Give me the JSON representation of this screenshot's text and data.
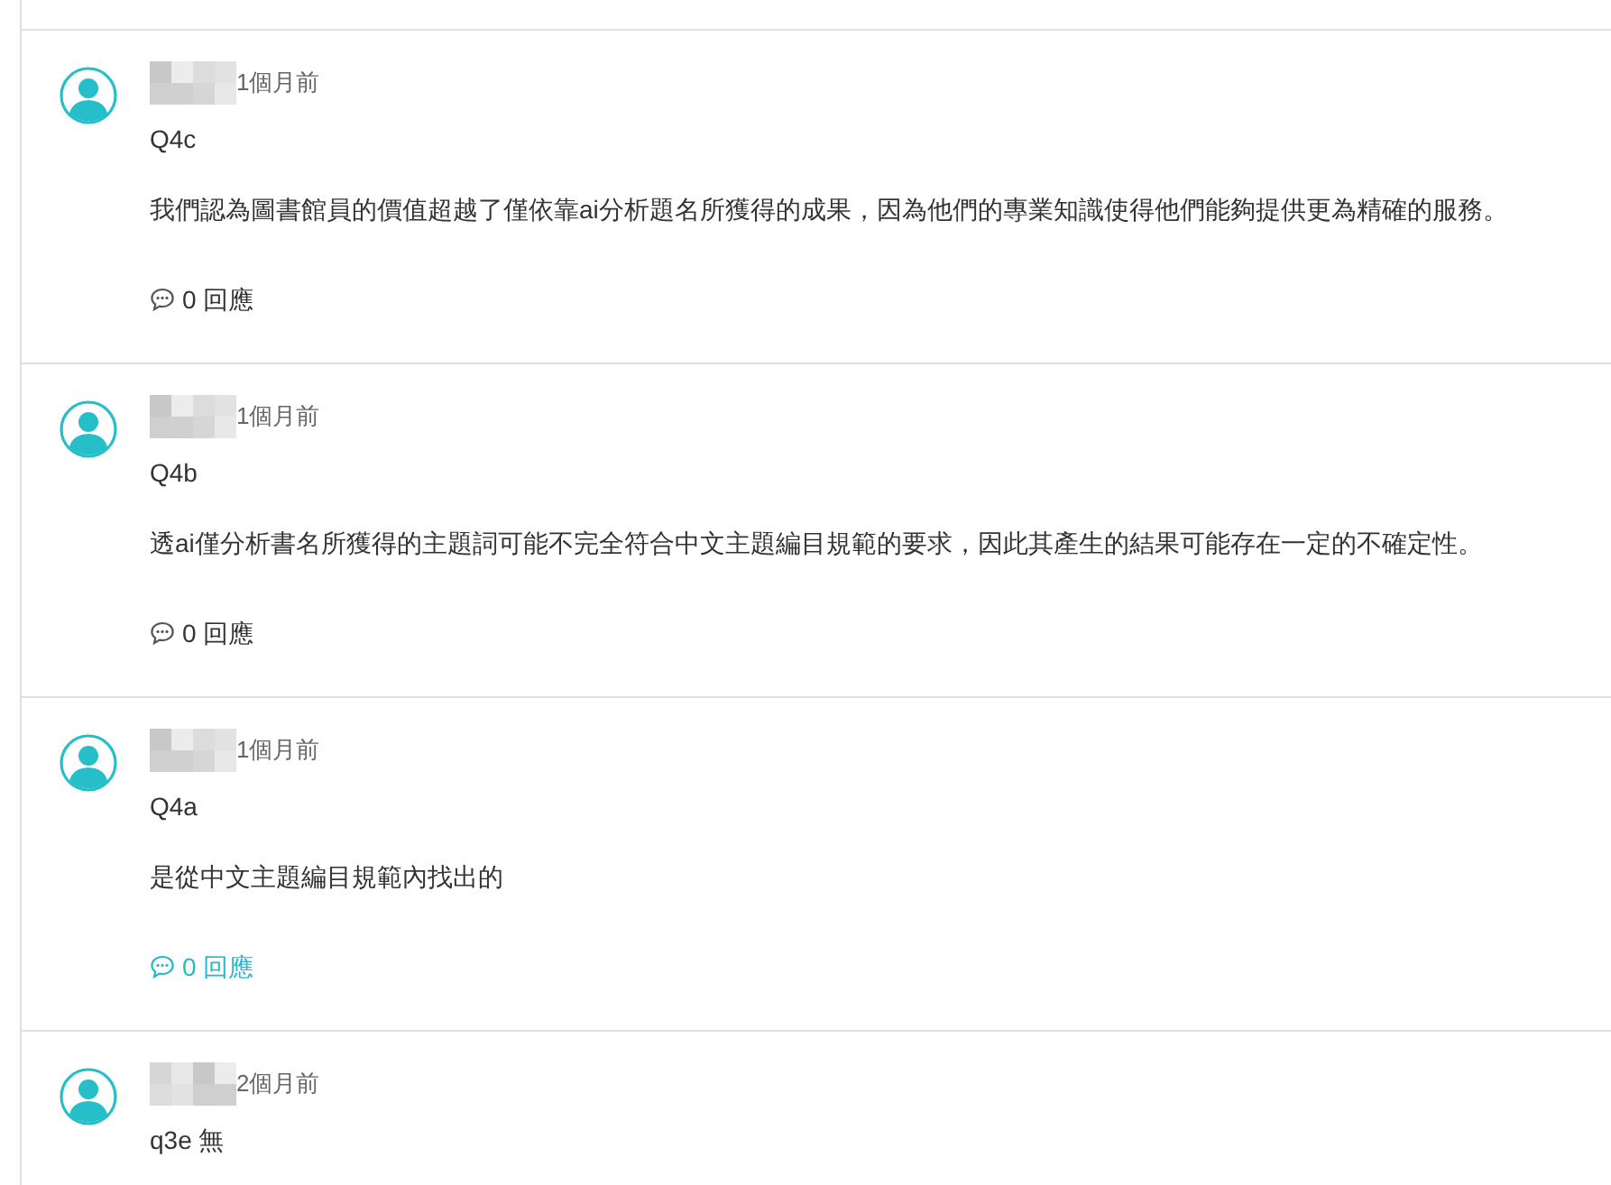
{
  "comments": [
    {
      "time": "1個月前",
      "title": "Q4c",
      "body": "我們認為圖書館員的價值超越了僅依靠ai分析題名所獲得的成果，因為他們的專業知識使得他們能夠提供更為精確的服務。",
      "replies": {
        "label": "0 回應",
        "highlighted": false
      }
    },
    {
      "time": "1個月前",
      "title": "Q4b",
      "body": "透ai僅分析書名所獲得的主題詞可能不完全符合中文主題編目規範的要求，因此其產生的結果可能存在一定的不確定性。",
      "replies": {
        "label": "0 回應",
        "highlighted": false
      }
    },
    {
      "time": "1個月前",
      "title": "Q4a",
      "body": "是從中文主題編目規範內找出的",
      "replies": {
        "label": "0 回應",
        "highlighted": true
      }
    },
    {
      "time": "2個月前",
      "title": "q3e 無"
    }
  ]
}
